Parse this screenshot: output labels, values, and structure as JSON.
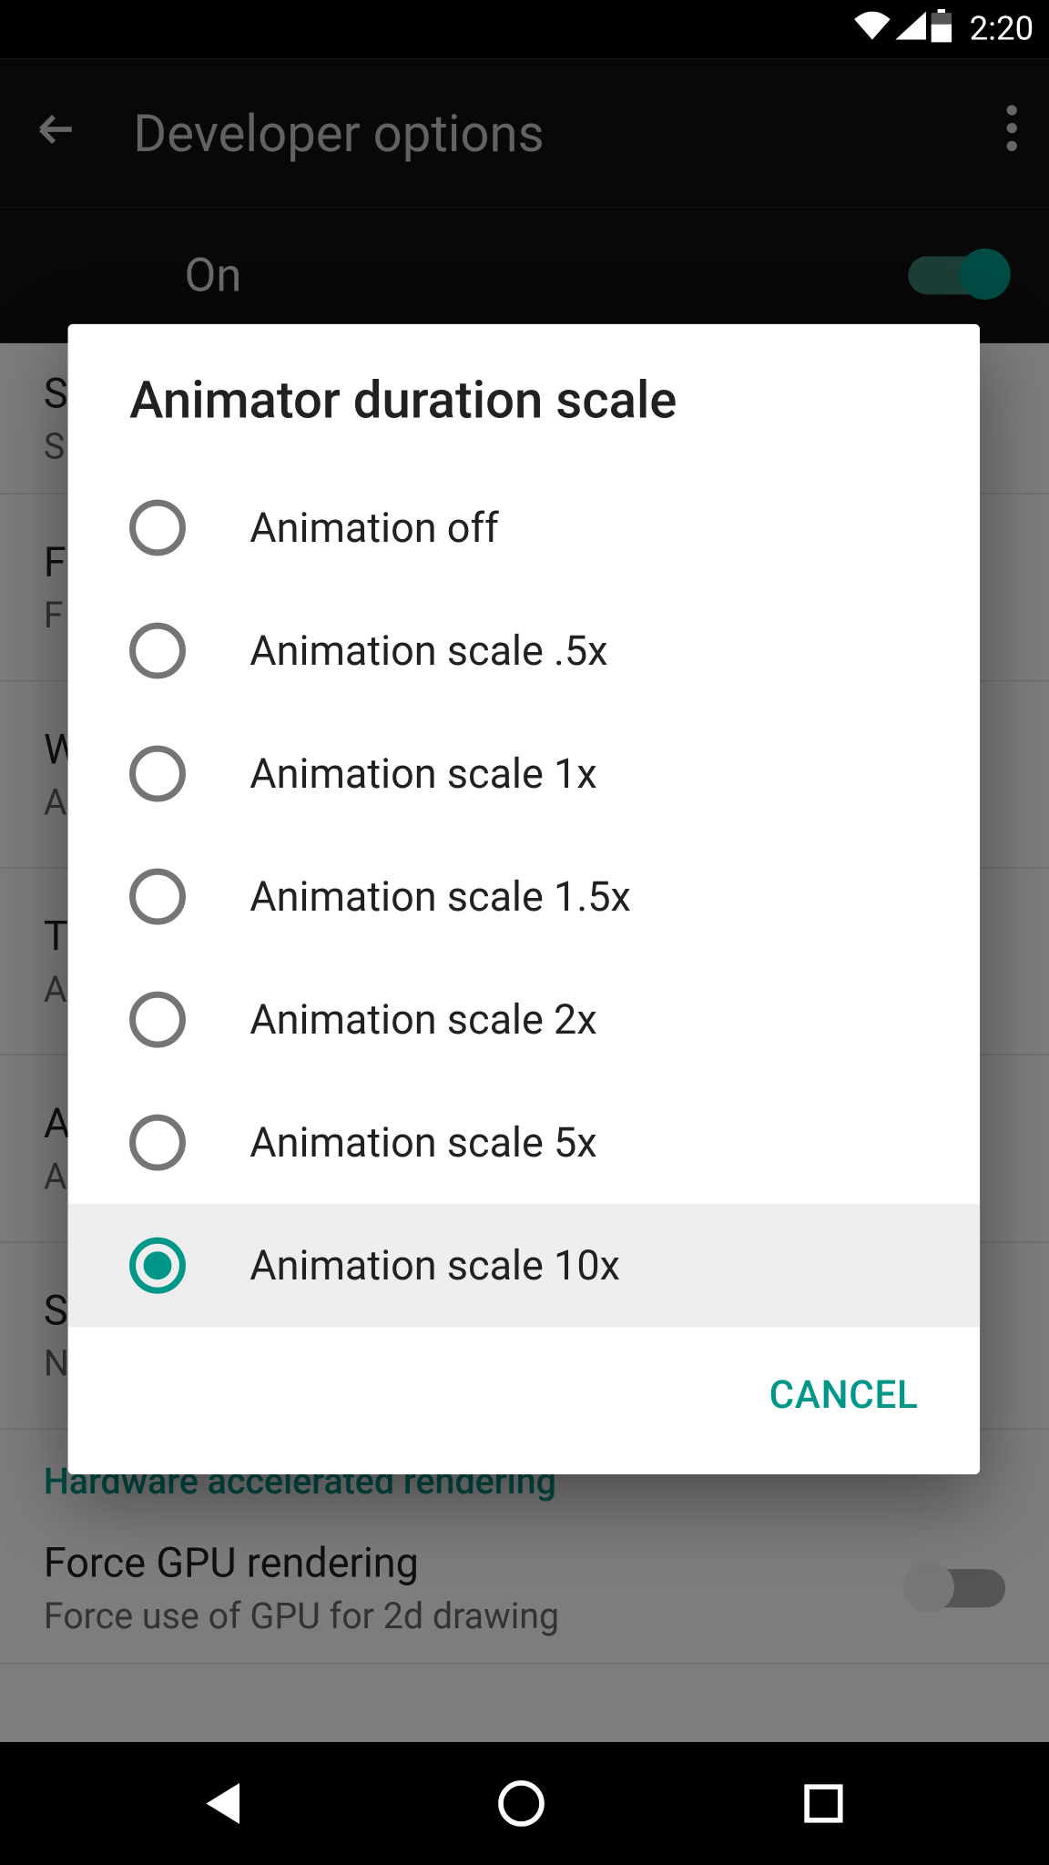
{
  "status": {
    "time": "2:20"
  },
  "app": {
    "title": "Developer options",
    "on_label": "On"
  },
  "settings": {
    "items": [
      {
        "title_partial": "S",
        "sub_partial": "S"
      },
      {
        "title_partial": "F",
        "sub_partial": "F"
      },
      {
        "title_partial": "W",
        "sub_partial": "A"
      },
      {
        "title_partial": "T",
        "sub_partial": "A"
      },
      {
        "title_partial": "A",
        "sub_partial": "A"
      },
      {
        "title_partial": "S",
        "sub_partial": "N"
      }
    ],
    "section_header": "Hardware accelerated rendering",
    "gpu": {
      "title": "Force GPU rendering",
      "sub": "Force use of GPU for 2d drawing"
    }
  },
  "dialog": {
    "title": "Animator duration scale",
    "options": [
      {
        "label": "Animation off",
        "selected": false
      },
      {
        "label": "Animation scale .5x",
        "selected": false
      },
      {
        "label": "Animation scale 1x",
        "selected": false
      },
      {
        "label": "Animation scale 1.5x",
        "selected": false
      },
      {
        "label": "Animation scale 2x",
        "selected": false
      },
      {
        "label": "Animation scale 5x",
        "selected": false
      },
      {
        "label": "Animation scale 10x",
        "selected": true
      }
    ],
    "cancel_label": "CANCEL"
  }
}
